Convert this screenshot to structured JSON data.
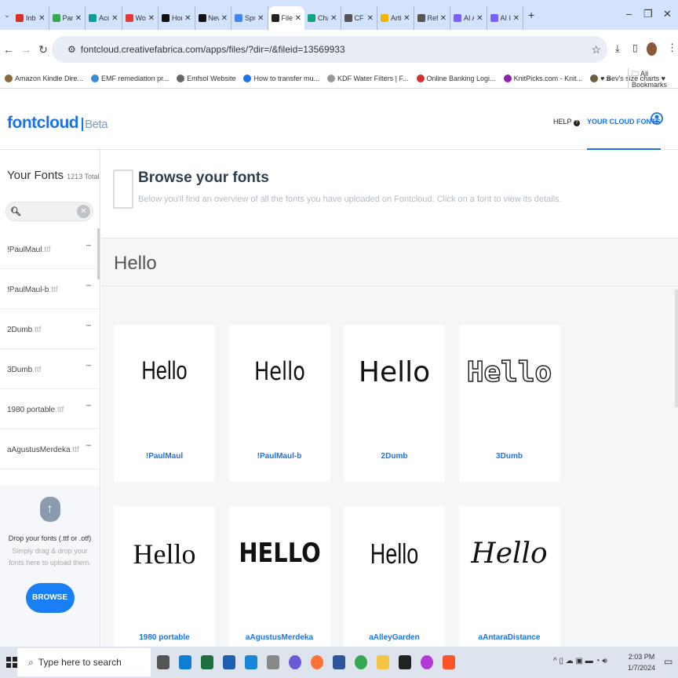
{
  "browser": {
    "tabs": [
      {
        "title": "Inbox",
        "color": "#d93025"
      },
      {
        "title": "Para",
        "color": "#34a853"
      },
      {
        "title": "Acc",
        "color": "#0f9d9a"
      },
      {
        "title": "Wor",
        "color": "#e53935"
      },
      {
        "title": "Hor",
        "color": "#111111"
      },
      {
        "title": "New",
        "color": "#111111"
      },
      {
        "title": "Spr",
        "color": "#4285f4"
      },
      {
        "title": "File",
        "color": "#222222",
        "active": true
      },
      {
        "title": "Cha",
        "color": "#10a37f"
      },
      {
        "title": "CF",
        "color": "#555555"
      },
      {
        "title": "Arti",
        "color": "#f4b400"
      },
      {
        "title": "Refi",
        "color": "#555555"
      },
      {
        "title": "AI A",
        "color": "#7b61ff"
      },
      {
        "title": "AI I",
        "color": "#7b61ff"
      }
    ],
    "url": "fontcloud.creativefabrica.com/apps/files/?dir=/&fileid=13569933",
    "bookmarks": [
      {
        "label": "Amazon Kindle Dire...",
        "color": "#8b6b3d"
      },
      {
        "label": "EMF remediation pr...",
        "color": "#3b8bd0"
      },
      {
        "label": "Emfsol Website",
        "color": "#666666"
      },
      {
        "label": "How to transfer mu...",
        "color": "#1a73e8"
      },
      {
        "label": "KDF Water Filters | F...",
        "color": "#999999"
      },
      {
        "label": "Online Banking Logi...",
        "color": "#d32f2f"
      },
      {
        "label": "KnitPicks.com - Knit...",
        "color": "#8e24aa"
      },
      {
        "label": "♥ Bev's size charts ♥",
        "color": "#6d5d3a"
      }
    ],
    "bookmarks_overflow": "»",
    "all_bookmarks": "All Bookmarks"
  },
  "header": {
    "logo": "fontcloud",
    "beta": "Beta",
    "help": "HELP",
    "cloud_fonts": "YOUR CLOUD FONTS"
  },
  "sidebar": {
    "title": "Your Fonts",
    "total": "1213 Total",
    "fonts": [
      {
        "name": "!PaulMaul",
        "ext": ".ttf"
      },
      {
        "name": "!PaulMaul-b",
        "ext": ".ttf"
      },
      {
        "name": "2Dumb",
        "ext": ".ttf"
      },
      {
        "name": "3Dumb",
        "ext": ".ttf"
      },
      {
        "name": "1980 portable",
        "ext": ".ttf"
      },
      {
        "name": "aAgustusMerdeka",
        "ext": ".ttf"
      }
    ],
    "drop_title": "Drop your fonts (.ttf or .otf)",
    "drop_hint": "Simply drag & drop your fonts here to upload them.",
    "browse": "BROWSE"
  },
  "main": {
    "title": "Browse your fonts",
    "subtitle": "Below you'll find an overview of all the fonts you have uploaded on Fontcloud. Click on a font to view its details.",
    "preview_text": "Hello",
    "cards": [
      {
        "name": "!PaulMaul",
        "sample": "Hello"
      },
      {
        "name": "!PaulMaul-b",
        "sample": "Hello"
      },
      {
        "name": "2Dumb",
        "sample": "Hello"
      },
      {
        "name": "3Dumb",
        "sample": "Hello"
      },
      {
        "name": "1980 portable",
        "sample": "Hello"
      },
      {
        "name": "aAgustusMerdeka",
        "sample": "HELLO"
      },
      {
        "name": "aAlleyGarden",
        "sample": "Hello"
      },
      {
        "name": "aAntaraDistance",
        "sample": "Hello"
      }
    ]
  },
  "taskbar": {
    "search_placeholder": "Type here to search",
    "time": "2:03 PM",
    "date": "1/7/2024"
  }
}
